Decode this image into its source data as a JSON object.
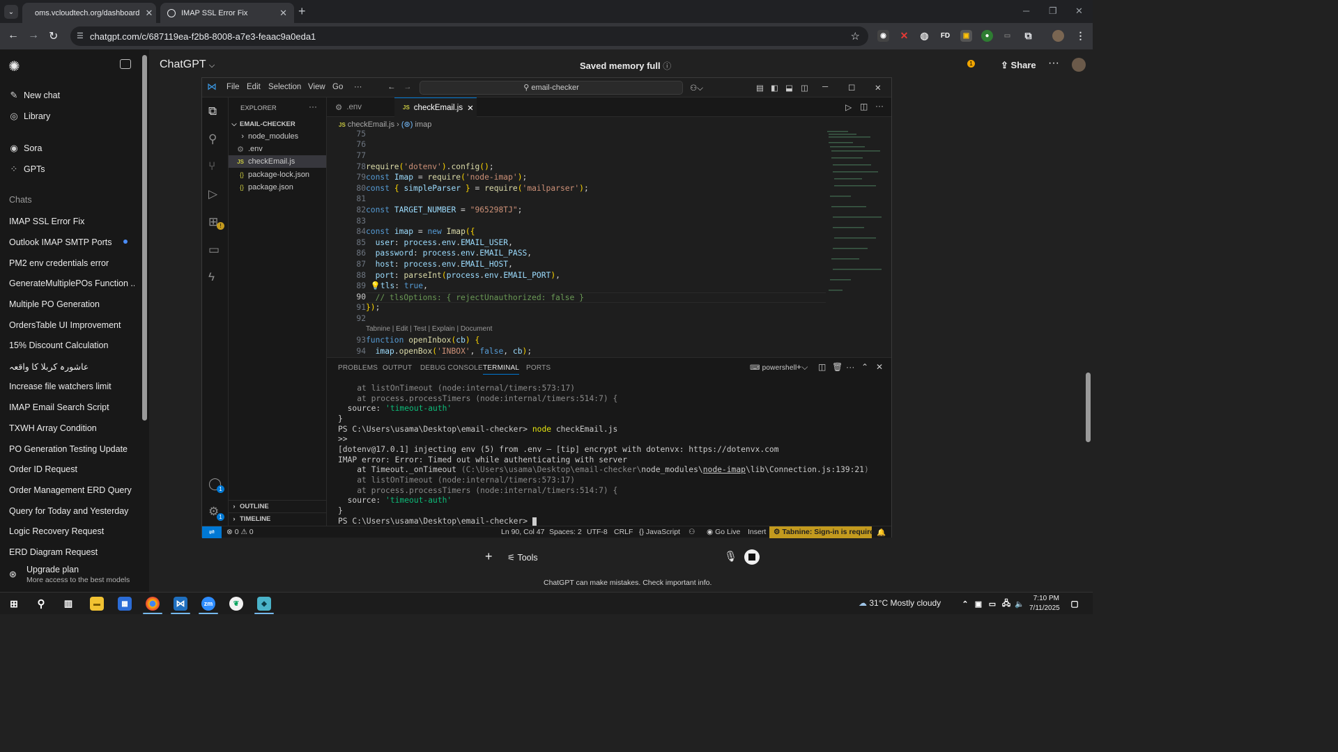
{
  "browser": {
    "tabs": [
      {
        "title": "oms.vcloudtech.org/dashboard"
      },
      {
        "title": "IMAP SSL Error Fix"
      }
    ],
    "url": "chatgpt.com/c/687119ea-f2b8-8008-a7e3-feaac9a0eda1",
    "extensions": [
      "FD"
    ],
    "extension_badge": "1"
  },
  "sidebar": {
    "top_items": [
      {
        "label": "New chat",
        "icon": "edit-icon"
      },
      {
        "label": "Library",
        "icon": "library-icon"
      },
      {
        "label": "Sora",
        "icon": "sora-icon"
      },
      {
        "label": "GPTs",
        "icon": "gpts-icon"
      }
    ],
    "chats_label": "Chats",
    "chats": [
      "IMAP SSL Error Fix",
      "Outlook IMAP SMTP Ports",
      "PM2 env credentials error",
      "GenerateMultiplePOs Function ...",
      "Multiple PO Generation",
      "OrdersTable UI Improvement",
      "15% Discount Calculation",
      "عاشورہ کربلا کا واقعہ",
      "Increase file watchers limit",
      "IMAP Email Search Script",
      "TXWH Array Condition",
      "PO Generation Testing Update",
      "Order ID Request",
      "Order Management ERD Query",
      "Query for Today and Yesterday",
      "Logic Recovery Request",
      "ERD Diagram Request"
    ],
    "upgrade": {
      "title": "Upgrade plan",
      "subtitle": "More access to the best models"
    }
  },
  "chatgpt": {
    "title": "ChatGPT",
    "memory_notice": "Saved memory full",
    "share_label": "Share",
    "tools_label": "Tools",
    "disclaimer": "ChatGPT can make mistakes. Check important info."
  },
  "vscode": {
    "menu": [
      "File",
      "Edit",
      "Selection",
      "View",
      "Go",
      "···"
    ],
    "search": "email-checker",
    "explorer_title": "EXPLORER",
    "project": "EMAIL-CHECKER",
    "files": [
      {
        "name": "node_modules",
        "icon": "›"
      },
      {
        "name": ".env",
        "icon": "⚙"
      },
      {
        "name": "checkEmail.js",
        "icon": "JS"
      },
      {
        "name": "package-lock.json",
        "icon": "{}"
      },
      {
        "name": "package.json",
        "icon": "{}"
      }
    ],
    "outline": "OUTLINE",
    "timeline": "TIMELINE",
    "tabs": [
      ".env",
      "checkEmail.js"
    ],
    "breadcrumb": {
      "file": "checkEmail.js",
      "symbol": "imap"
    },
    "line_numbers": [
      "75",
      "76",
      "77",
      "78",
      "79",
      "80",
      "81",
      "82",
      "83",
      "84",
      "85",
      "86",
      "87",
      "88",
      "89",
      "90",
      "91",
      "92",
      "93",
      "94"
    ],
    "code_lens": "Tabnine | Edit | Test | Explain | Document",
    "panel_tabs": [
      "PROBLEMS",
      "OUTPUT",
      "DEBUG CONSOLE",
      "TERMINAL",
      "PORTS"
    ],
    "shell": "powershell",
    "terminal": [
      "    at listOnTimeout (node:internal/timers:573:17)",
      "    at process.processTimers (node:internal/timers:514:7) {",
      "  source: 'timeout-auth'",
      "}",
      "PS C:\\Users\\usama\\Desktop\\email-checker> node checkEmail.js",
      ">>",
      "[dotenv@17.0.1] injecting env (5) from .env – [tip] encrypt with dotenvx: https://dotenvx.com",
      "IMAP error: Error: Timed out while authenticating with server",
      "    at Timeout._onTimeout (C:\\Users\\usama\\Desktop\\email-checker\\node_modules\\node-imap\\lib\\Connection.js:139:21)",
      "    at listOnTimeout (node:internal/timers:573:17)",
      "    at process.processTimers (node:internal/timers:514:7) {",
      "  source: 'timeout-auth'",
      "}",
      "PS C:\\Users\\usama\\Desktop\\email-checker> "
    ],
    "status": {
      "problems": "⊗ 0 ⚠ 0",
      "position": "Ln 90, Col 47",
      "spaces": "Spaces: 2",
      "encoding": "UTF-8",
      "eol": "CRLF",
      "language": "{} JavaScript",
      "golive": "Go Live",
      "mode": "Insert",
      "tabnine": "Tabnine: Sign-in is required"
    },
    "accent": "#0078d4"
  },
  "taskbar": {
    "weather": "31°C  Mostly cloudy",
    "time": "7:10 PM",
    "date": "7/11/2025"
  }
}
